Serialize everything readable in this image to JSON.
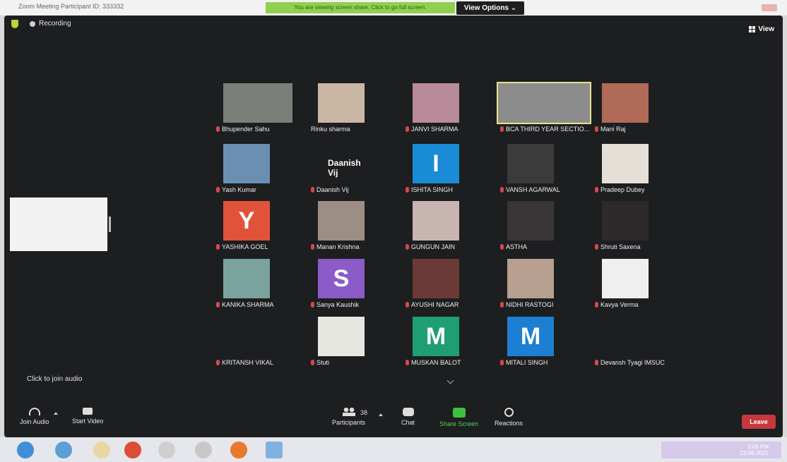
{
  "window": {
    "title": "Zoom Meeting Participant ID: 333332",
    "share_banner": "You are viewing screen share. Click to go full screen.",
    "view_options": "View Options ⌄"
  },
  "topbar": {
    "recording": "Recording",
    "view": "View"
  },
  "participants": [
    {
      "name": "Bhupender Sahu",
      "type": "video",
      "color": "#7a7f79"
    },
    {
      "name": "Rinku sharma",
      "type": "video",
      "color": "#c9b7a4"
    },
    {
      "name": "JANVI SHARMA",
      "type": "video",
      "color": "#b98a9a"
    },
    {
      "name": "BCA THIRD YEAR SECTIO...",
      "type": "video",
      "color": "#8c8c8c"
    },
    {
      "name": "Mani Raj",
      "type": "video",
      "color": "#b06a58"
    },
    {
      "name": "Yash Kumar",
      "type": "video",
      "color": "#6a8fb3"
    },
    {
      "name": "Daanish Vij",
      "type": "name",
      "color": "#1d1e20"
    },
    {
      "name": "ISHITA SINGH",
      "type": "letter",
      "letter": "I",
      "color": "#1a8bd6"
    },
    {
      "name": "VANSH AGARWAL",
      "type": "video",
      "color": "#3b3b3b"
    },
    {
      "name": "Pradeep Dubey",
      "type": "video",
      "color": "#e6dfd8"
    },
    {
      "name": "YASHIKA GOEL",
      "type": "letter",
      "letter": "Y",
      "color": "#e0533a"
    },
    {
      "name": "Manan Krishna",
      "type": "video",
      "color": "#9c8e84"
    },
    {
      "name": "GUNGUN JAIN",
      "type": "video",
      "color": "#c8b5b2"
    },
    {
      "name": "ASTHA",
      "type": "video",
      "color": "#3a3536"
    },
    {
      "name": "Shruti Saxena",
      "type": "video",
      "color": "#2e2a2c"
    },
    {
      "name": "KANIKA SHARMA",
      "type": "video",
      "color": "#7aa39e"
    },
    {
      "name": "Sanya Kaushik",
      "type": "letter",
      "letter": "S",
      "color": "#8b5bc7"
    },
    {
      "name": "AYUSHI NAGAR",
      "type": "video",
      "color": "#6b3a36"
    },
    {
      "name": "NIDHI RASTOGI",
      "type": "video",
      "color": "#b7a08f"
    },
    {
      "name": "Kavya Verma",
      "type": "video",
      "color": "#efefef"
    },
    {
      "name": "KRITANSH VIKAL",
      "type": "video",
      "color": "#1d1e20"
    },
    {
      "name": "Stuti",
      "type": "video",
      "color": "#e7e7e2"
    },
    {
      "name": "MUSKAN BALOT",
      "type": "letter",
      "letter": "M",
      "color": "#1f9e73"
    },
    {
      "name": "MITALI SINGH",
      "type": "letter",
      "letter": "M",
      "color": "#1d7fd2"
    },
    {
      "name": "Devansh Tyagi IMSUC",
      "type": "none",
      "color": "#1d1e20"
    }
  ],
  "notice": "Click to join audio",
  "toolbar": {
    "join_audio": "Join Audio",
    "start_video": "Start Video",
    "participants": "Participants",
    "participants_count": "38",
    "chat": "Chat",
    "share_screen": "Share Screen",
    "reactions": "Reactions",
    "leave": "Leave"
  },
  "taskbar": {
    "time": "3:05 PM",
    "date": "13-06-2021"
  }
}
